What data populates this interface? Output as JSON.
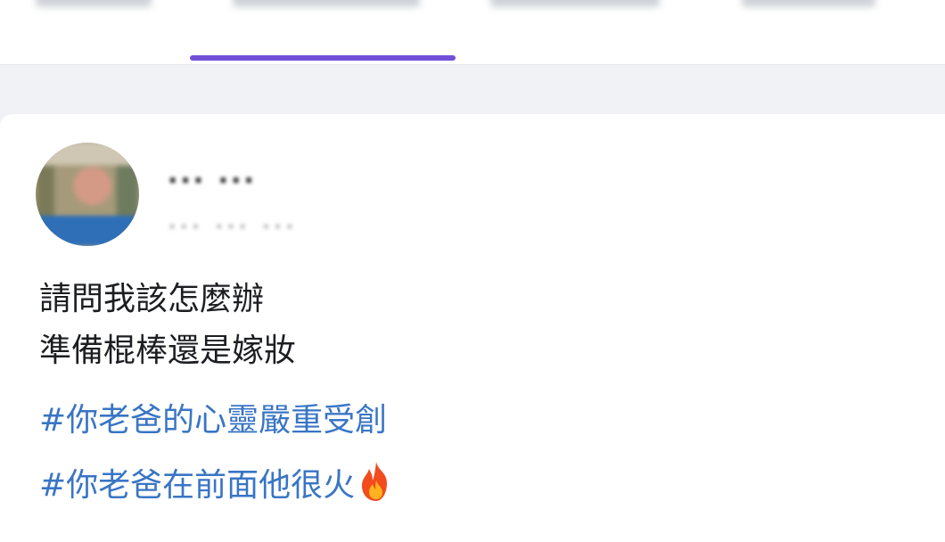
{
  "tabs": [
    {
      "label": ""
    },
    {
      "label": "",
      "active": true
    },
    {
      "label": ""
    },
    {
      "label": ""
    }
  ],
  "post": {
    "author": "... ...",
    "meta": "... ... ...",
    "lines": [
      "請問我該怎麼辦",
      "準備棍棒還是嫁妝"
    ],
    "hashtags": [
      "#你老爸的心靈嚴重受創",
      "#你老爸在前面他很火"
    ],
    "icons": {
      "avatar": "profile-photo-blurred",
      "emoji": "fire-icon"
    }
  },
  "colors": {
    "active_tab": "#7450d8",
    "hashtag": "#3975c5",
    "text": "#1c1e21"
  }
}
